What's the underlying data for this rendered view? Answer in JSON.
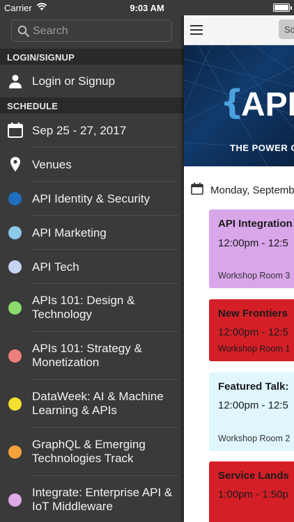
{
  "status_bar": {
    "carrier": "Carrier",
    "time": "9:03 AM",
    "battery_level": 1.0
  },
  "sidebar": {
    "search_placeholder": "Search",
    "sections": {
      "login": "LOGIN/SIGNUP",
      "schedule": "SCHEDULE"
    },
    "login_item": {
      "label": "Login or Signup",
      "icon": "person-icon"
    },
    "date_item": {
      "label": "Sep 25 - 27, 2017",
      "icon": "calendar-icon"
    },
    "venues_item": {
      "label": "Venues",
      "icon": "map-pin-icon"
    },
    "tracks": [
      {
        "label": "API Identity & Security",
        "color": "#1e6fbf"
      },
      {
        "label": "API Marketing",
        "color": "#8ec9ea"
      },
      {
        "label": "API Tech",
        "color": "#c7d4f5"
      },
      {
        "label": "APIs 101: Design & Technology",
        "color": "#8bdc6a"
      },
      {
        "label": "APIs 101: Strategy & Monetization",
        "color": "#ee7f7c"
      },
      {
        "label": "DataWeek: AI & Machine Learning & APIs",
        "color": "#f3df2d"
      },
      {
        "label": "GraphQL & Emerging Technologies Track",
        "color": "#f4a23a"
      },
      {
        "label": "Integrate: Enterprise API & IoT Middleware",
        "color": "#dfa9e8"
      }
    ]
  },
  "main": {
    "segment_label": "Sc",
    "banner": {
      "brace": "{",
      "title": "API",
      "tagline": "THE POWER O"
    },
    "day_label": "Monday, September",
    "sessions": [
      {
        "title": "API Integration",
        "time": "12:00pm - 12:5",
        "room": "Workshop Room 3",
        "color": "#d9a6ea"
      },
      {
        "title": "New Frontiers",
        "time": "12:00pm - 12:5",
        "room": "Workshop Room 1",
        "color": "#d51f27"
      },
      {
        "title": "Featured Talk:",
        "time": "12:00pm - 12:5",
        "room": "Workshop Room 2",
        "color": "#dff6fd"
      },
      {
        "title": "Service Lands",
        "time": "1:00pm - 1:50p",
        "room": "",
        "color": "#d51f27"
      }
    ]
  }
}
